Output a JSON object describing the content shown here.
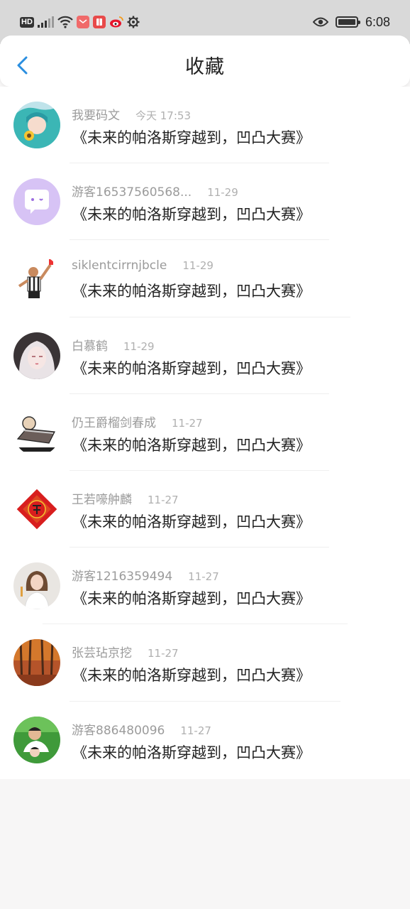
{
  "status_bar": {
    "left_badge": "HD",
    "network": "5G",
    "time": "6:08"
  },
  "header": {
    "title": "收藏"
  },
  "favorites": [
    {
      "name": "我要码文",
      "time": "今天 17:53",
      "content": "《未来的帕洛斯穿越到，凹凸大赛》"
    },
    {
      "name": "游客16537560568...",
      "time": "11-29",
      "content": "《未来的帕洛斯穿越到，凹凸大赛》"
    },
    {
      "name": "siklentcirrnjbcle",
      "time": "11-29",
      "content": "《未来的帕洛斯穿越到，凹凸大赛》"
    },
    {
      "name": "白慕鹤",
      "time": "11-29",
      "content": "《未来的帕洛斯穿越到，凹凸大赛》"
    },
    {
      "name": "仍王爵榴剑春成",
      "time": "11-27",
      "content": "《未来的帕洛斯穿越到，凹凸大赛》"
    },
    {
      "name": "王若嚎舯麟",
      "time": "11-27",
      "content": "《未来的帕洛斯穿越到，凹凸大赛》"
    },
    {
      "name": "游客1216359494",
      "time": "11-27",
      "content": "《未来的帕洛斯穿越到，凹凸大赛》"
    },
    {
      "name": "张芸玷京挖",
      "time": "11-27",
      "content": "《未来的帕洛斯穿越到，凹凸大赛》"
    },
    {
      "name": "游客886480096",
      "time": "11-27",
      "content": "《未来的帕洛斯穿越到，凹凸大赛》"
    }
  ],
  "colors": {
    "accent": "#2a8ee0",
    "status_bar_bg": "#d9d9d9",
    "page_bg": "#f7f6f6"
  }
}
